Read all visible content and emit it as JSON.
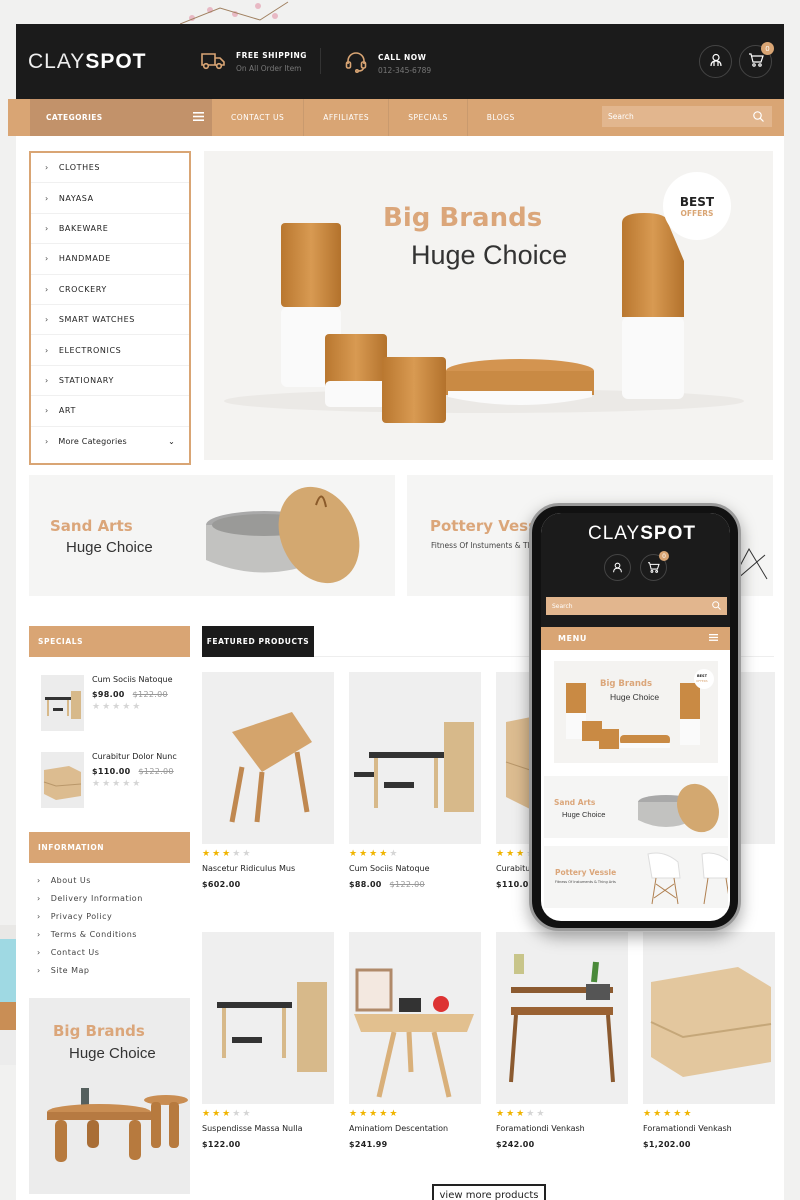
{
  "brand": {
    "name_light": "CLAY",
    "name_bold": "SPOT"
  },
  "header": {
    "shipping": {
      "title": "FREE SHIPPING",
      "subtitle": "On All Order Item"
    },
    "call": {
      "title": "CALL NOW",
      "subtitle": "012-345-6789"
    },
    "cart_count": "0"
  },
  "nav": {
    "categories_label": "CATEGORIES",
    "links": [
      "CONTACT US",
      "AFFILIATES",
      "SPECIALS",
      "BLOGS"
    ],
    "search_placeholder": "Search"
  },
  "categories": [
    "CLOTHES",
    "NAYASA",
    "BAKEWARE",
    "HANDMADE",
    "CROCKERY",
    "SMART WATCHES",
    "ELECTRONICS",
    "STATIONARY",
    "ART"
  ],
  "more_categories": "More Categories",
  "hero": {
    "line1": "Big Brands",
    "line2": "Huge Choice",
    "badge_top": "BEST",
    "badge_bottom": "OFFERS"
  },
  "banners": [
    {
      "title": "Sand Arts",
      "subtitle": "Huge Choice"
    },
    {
      "title": "Pottery Vessle",
      "subtitle": "Fitness Of Instuments & Thing Arts"
    }
  ],
  "specials": {
    "heading": "SPECIALS",
    "items": [
      {
        "name": "Cum Sociis Natoque",
        "price": "$98.00",
        "old_price": "$122.00",
        "rating": 0
      },
      {
        "name": "Curabitur Dolor Nunc",
        "price": "$110.00",
        "old_price": "$122.00",
        "rating": 0
      }
    ]
  },
  "information": {
    "heading": "INFORMATION",
    "links": [
      "About Us",
      "Delivery Information",
      "Privacy Policy",
      "Terms & Conditions",
      "Contact Us",
      "Site Map"
    ]
  },
  "side_banner": {
    "line1": "Big Brands",
    "line2": "Huge Choice"
  },
  "featured": {
    "tab": "FEATURED PRODUCTS",
    "products": [
      {
        "name": "Nascetur Ridiculus Mus",
        "price": "$602.00",
        "old_price": "",
        "rating": 3
      },
      {
        "name": "Cum Sociis Natoque",
        "price": "$88.00",
        "old_price": "$122.00",
        "rating": 4
      },
      {
        "name": "Curabitur Dolor Nunc",
        "price": "$110.00",
        "old_price": "",
        "rating": 3
      },
      {
        "name": "",
        "price": "",
        "old_price": "",
        "rating": 0
      },
      {
        "name": "Suspendisse Massa Nulla",
        "price": "$122.00",
        "old_price": "",
        "rating": 3
      },
      {
        "name": "Aminatiom Descentation",
        "price": "$241.99",
        "old_price": "",
        "rating": 5
      },
      {
        "name": "Foramationdi Venkash",
        "price": "$242.00",
        "old_price": "",
        "rating": 3
      },
      {
        "name": "Foramationdi Venkash",
        "price": "$1,202.00",
        "old_price": "",
        "rating": 5
      }
    ],
    "view_more": "view more products"
  },
  "mobile": {
    "search_placeholder": "Search",
    "menu_label": "MENU",
    "cart_count": "0",
    "hero": {
      "line1": "Big Brands",
      "line2": "Huge Choice",
      "badge_top": "BEST",
      "badge_bottom": "OFFERS"
    },
    "banners": [
      {
        "title": "Sand Arts",
        "subtitle": "Huge Choice"
      },
      {
        "title": "Pottery Vessle",
        "subtitle": "Fitness Of Instuments & Thing Arts"
      }
    ]
  },
  "colors": {
    "accent": "#d9a574",
    "dark": "#1b1b1b",
    "star": "#f0b400"
  }
}
